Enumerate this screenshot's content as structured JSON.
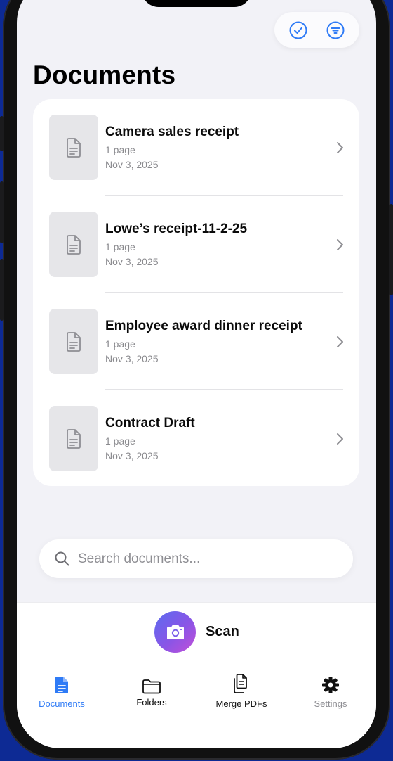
{
  "header": {
    "title": "Documents",
    "select_icon": "checkmark-circle-icon",
    "filter_icon": "filter-lines-icon"
  },
  "documents": [
    {
      "name": "Camera sales receipt",
      "pages": "1 page",
      "date": "Nov 3, 2025"
    },
    {
      "name": "Lowe’s receipt-11-2-25",
      "pages": "1 page",
      "date": "Nov 3, 2025"
    },
    {
      "name": "Employee award dinner receipt",
      "pages": "1 page",
      "date": "Nov 3, 2025"
    },
    {
      "name": "Contract Draft",
      "pages": "1 page",
      "date": "Nov 3, 2025"
    }
  ],
  "search": {
    "placeholder": "Search documents..."
  },
  "scan": {
    "label": "Scan",
    "icon": "camera-icon"
  },
  "tabs": {
    "documents": "Documents",
    "folders": "Folders",
    "merge": "Merge PDFs",
    "settings": "Settings"
  },
  "colors": {
    "accent": "#2f7bf6",
    "background": "#f2f2f7",
    "backdrop": "#0d2a94"
  }
}
